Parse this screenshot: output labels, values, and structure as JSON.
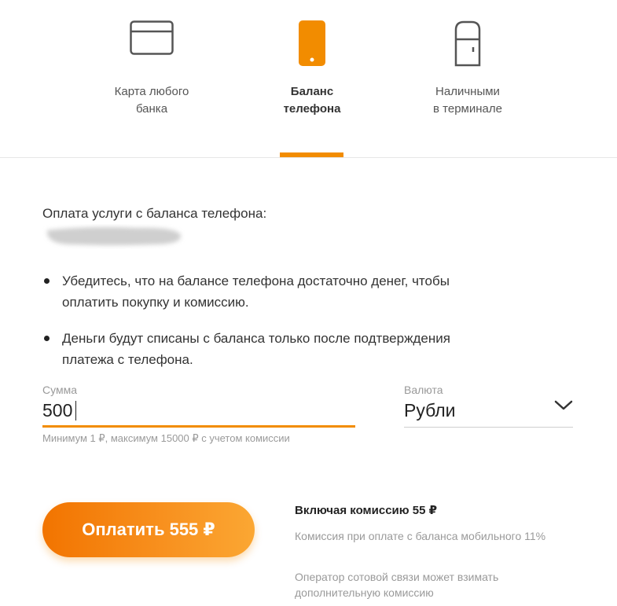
{
  "tabs": [
    {
      "line1": "Карта любого",
      "line2": "банка",
      "icon": "credit-card-icon",
      "active": false
    },
    {
      "line1": "Баланс",
      "line2": "телефона",
      "icon": "mobile-phone-icon",
      "active": true
    },
    {
      "line1": "Наличными",
      "line2": "в терминале",
      "icon": "payment-terminal-icon",
      "active": false
    }
  ],
  "colors": {
    "accent": "#f28c00",
    "muted": "#999999",
    "text": "#333333"
  },
  "intro": "Оплата услуги с баланса телефона:",
  "bullets": [
    "Убедитесь, что на балансе телефона достаточно денег, чтобы оплатить покупку и комиссию.",
    "Деньги будут списаны с баланса только после подтверждения платежа с телефона."
  ],
  "amount": {
    "label": "Сумма",
    "value": "500",
    "hint": "Минимум 1 ₽, максимум 15000 ₽ с учетом комиссии"
  },
  "currency": {
    "label": "Валюта",
    "selected": "Рубли"
  },
  "pay_button": "Оплатить 555 ₽",
  "fee": {
    "title": "Включая комиссию 55 ₽",
    "note1": "Комиссия при оплате с баланса мобильного 11%",
    "note2": "Оператор сотовой связи может взимать дополнительную комиссию"
  }
}
